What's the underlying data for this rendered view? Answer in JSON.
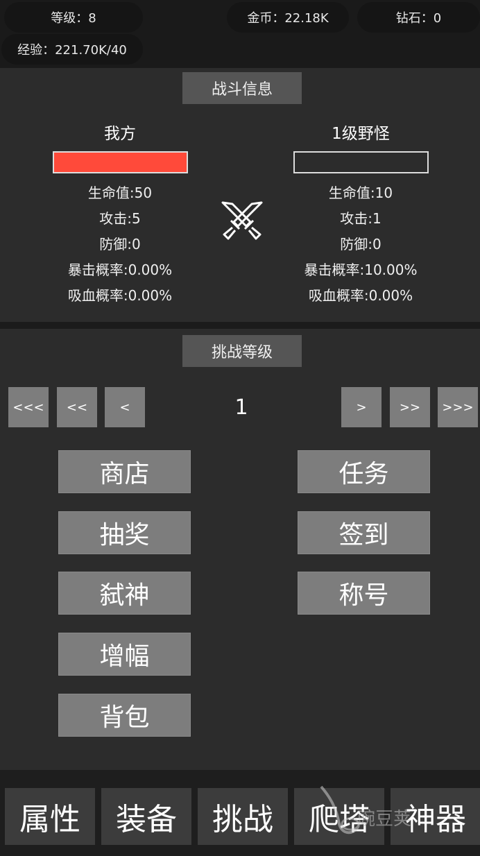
{
  "header": {
    "level": "等级：8",
    "gold": "金币：22.18K",
    "diamond": "钻石：0",
    "exp": "经验：221.70K/40"
  },
  "battle": {
    "title": "战斗信息",
    "player": {
      "name": "我方",
      "hp_fraction": 1.0,
      "stats": [
        "生命值:50",
        "攻击:5",
        "防御:0",
        "暴击概率:0.00%",
        "吸血概率:0.00%"
      ]
    },
    "enemy": {
      "name": "1级野怪",
      "hp_fraction": 0.0,
      "stats": [
        "生命值:10",
        "攻击:1",
        "防御:0",
        "暴击概率:10.00%",
        "吸血概率:0.00%"
      ]
    },
    "center_icon": "crossed-swords-icon"
  },
  "challenge": {
    "title": "挑战等级",
    "nav": [
      "<<<",
      "<<",
      "<",
      ">",
      ">>",
      ">>>"
    ],
    "current_level": "1"
  },
  "menu": {
    "left": [
      "商店",
      "抽奖",
      "弑神",
      "增幅",
      "背包"
    ],
    "right": [
      "任务",
      "签到",
      "称号"
    ]
  },
  "tabs": [
    "属性",
    "装备",
    "挑战",
    "爬塔",
    "神器"
  ],
  "watermark": "豌豆荚",
  "colors": {
    "hp_fill": "#ff4a3a",
    "button": "#7d7d7d",
    "panel": "#2c2c2c"
  }
}
